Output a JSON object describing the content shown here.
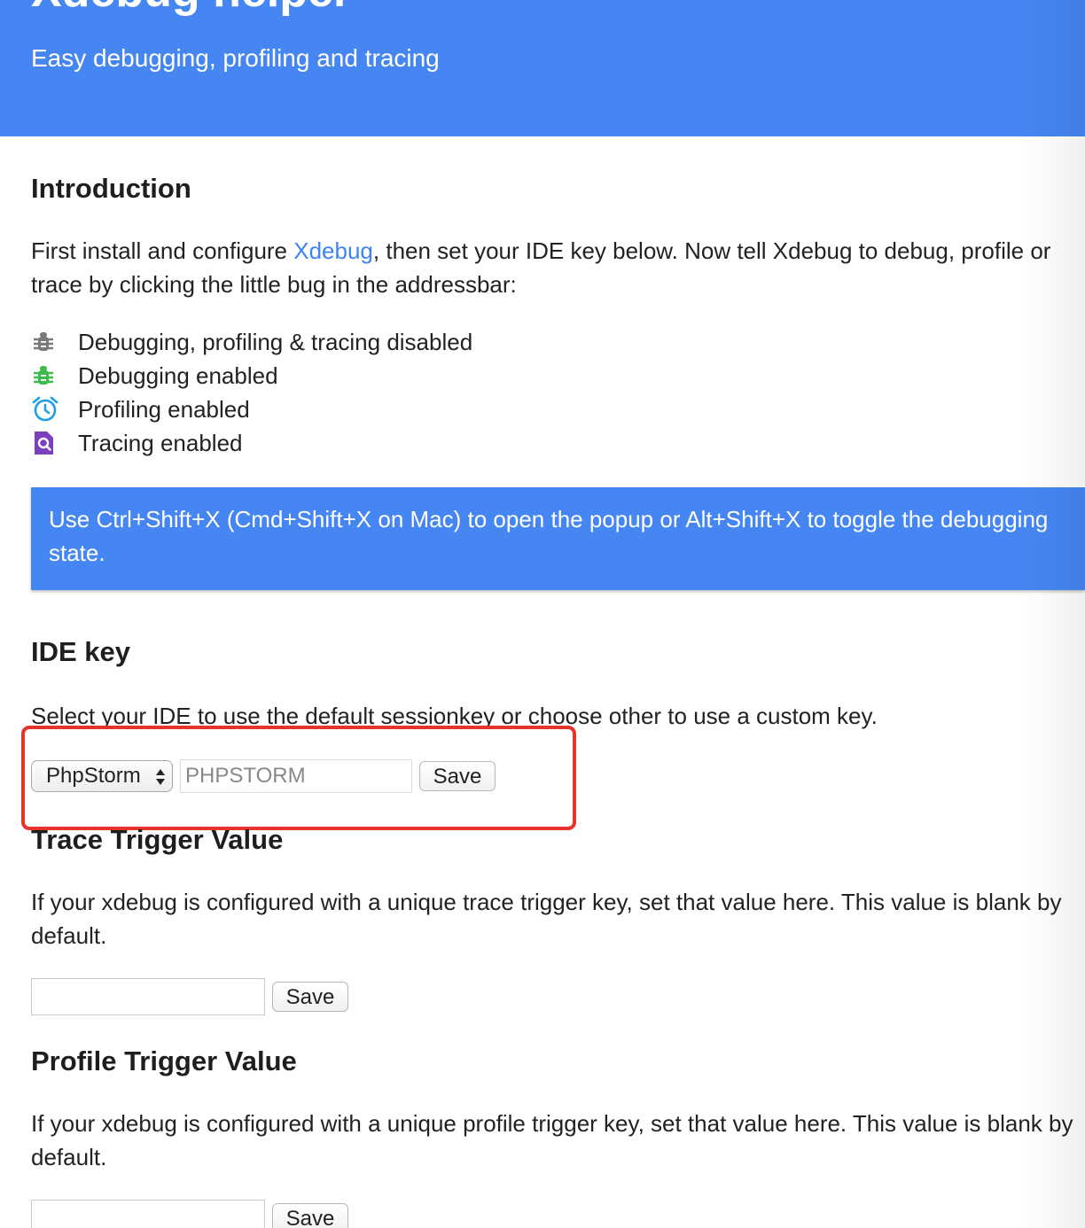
{
  "header": {
    "title": "Xdebug helper",
    "subtitle": "Easy debugging, profiling and tracing",
    "background_color": "#4586f2"
  },
  "intro": {
    "heading": "Introduction",
    "text_before_link": "First install and configure ",
    "link_text": "Xdebug",
    "text_after_link": ", then set your IDE key below. Now tell Xdebug to debug, profile or trace by clicking the little bug in the addressbar:",
    "legend": [
      {
        "icon": "bug-gray-icon",
        "label": "Debugging, profiling & tracing disabled",
        "color": "#7a7a7a"
      },
      {
        "icon": "bug-green-icon",
        "label": "Debugging enabled",
        "color": "#3dbb4c"
      },
      {
        "icon": "alarm-clock-icon",
        "label": "Profiling enabled",
        "color": "#1f9ee8"
      },
      {
        "icon": "file-search-icon",
        "label": "Tracing enabled",
        "color": "#7b3fc0"
      }
    ]
  },
  "notice": {
    "text": "Use Ctrl+Shift+X (Cmd+Shift+X on Mac) to open the popup or Alt+Shift+X to toggle the debugging state."
  },
  "ide_key": {
    "heading": "IDE key",
    "text": "Select your IDE to use the default sessionkey or choose other to use a custom key.",
    "select_value": "PhpStorm",
    "key_value": "PHPSTORM",
    "save_label": "Save",
    "highlight_color": "#e8332c"
  },
  "trace": {
    "heading": "Trace Trigger Value",
    "text": "If your xdebug is configured with a unique trace trigger key, set that value here. This value is blank by default.",
    "value": "",
    "save_label": "Save"
  },
  "profile": {
    "heading": "Profile Trigger Value",
    "text": "If your xdebug is configured with a unique profile trigger key, set that value here. This value is blank by default.",
    "value": "",
    "save_label": "Save"
  }
}
